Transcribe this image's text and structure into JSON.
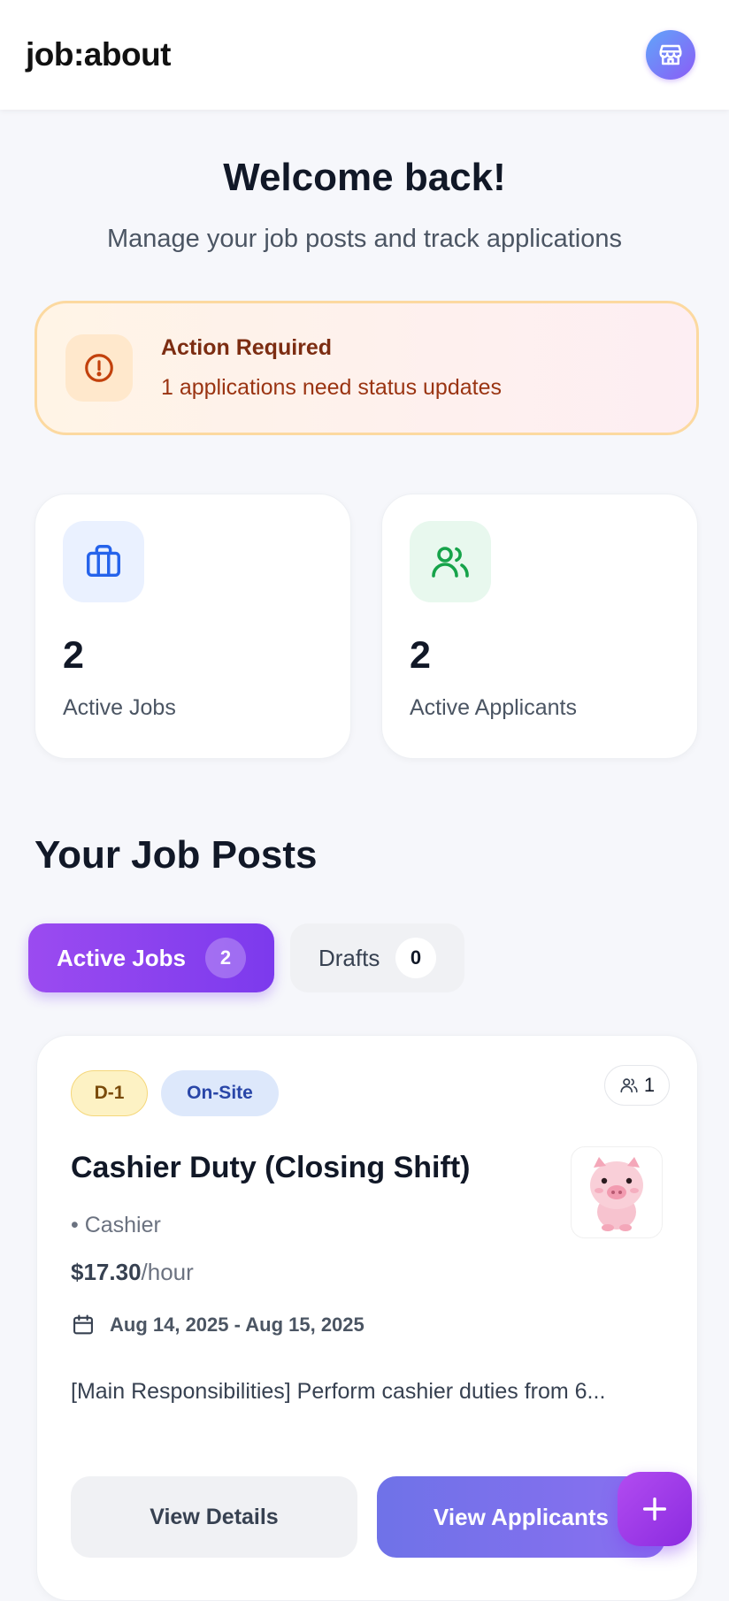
{
  "app": {
    "brand": "job:about"
  },
  "header": {
    "store_icon": "store-icon"
  },
  "welcome": {
    "title": "Welcome back!",
    "subtitle": "Manage your job posts and track applications"
  },
  "alert": {
    "title": "Action Required",
    "message": "1 applications need status updates",
    "icon": "alert-circle-icon",
    "color": "#c2410c"
  },
  "stats": [
    {
      "value": "2",
      "label": "Active Jobs",
      "icon": "briefcase-icon",
      "color": "#2563eb"
    },
    {
      "value": "2",
      "label": "Active Applicants",
      "icon": "users-icon",
      "color": "#16a34a"
    }
  ],
  "section": {
    "title": "Your Job Posts"
  },
  "tabs": [
    {
      "label": "Active Jobs",
      "count": "2",
      "active": true
    },
    {
      "label": "Drafts",
      "count": "0",
      "active": false
    }
  ],
  "job": {
    "deadline_badge": "D-1",
    "location_badge": "On-Site",
    "applicant_count": "1",
    "title": "Cashier Duty (Closing Shift)",
    "category": "• Cashier",
    "pay_amount": "$17.30",
    "pay_unit": "/hour",
    "date_range": "Aug 14, 2025 - Aug 15, 2025",
    "description": "[Main Responsibilities] Perform cashier duties from 6...",
    "details_button": "View Details",
    "applicants_button": "View Applicants",
    "thumbnail_icon": "pig-mascot-image"
  },
  "fab": {
    "icon": "plus-icon"
  },
  "colors": {
    "accent": "#7c3aed",
    "primary_button": "#7c6ff0"
  }
}
